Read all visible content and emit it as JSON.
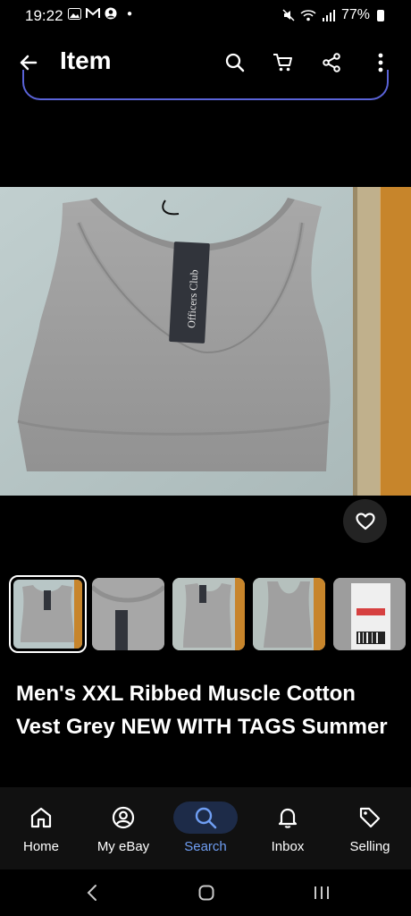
{
  "status_bar": {
    "time": "19:22",
    "battery": "77%"
  },
  "app_bar": {
    "title": "Item"
  },
  "product": {
    "title": "Men's XXL Ribbed Muscle Cotton Vest Grey NEW WITH TAGS Summer",
    "tag_text": "Officers Club"
  },
  "thumbnails": [
    {
      "selected": true
    },
    {
      "selected": false
    },
    {
      "selected": false
    },
    {
      "selected": false
    },
    {
      "selected": false
    }
  ],
  "bottom_nav": {
    "items": [
      {
        "label": "Home",
        "icon": "home-icon"
      },
      {
        "label": "My eBay",
        "icon": "account-icon"
      },
      {
        "label": "Search",
        "icon": "search-icon",
        "active": true
      },
      {
        "label": "Inbox",
        "icon": "bell-icon"
      },
      {
        "label": "Selling",
        "icon": "tag-icon"
      }
    ]
  },
  "colors": {
    "accent_active": "#6f9ef3",
    "active_pill": "#1d2b48"
  }
}
